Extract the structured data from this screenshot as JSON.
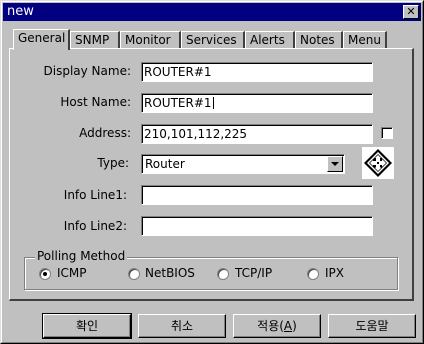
{
  "window": {
    "title": "new",
    "close_glyph": "✕"
  },
  "tabs": [
    {
      "label": "General",
      "active": true
    },
    {
      "label": "SNMP"
    },
    {
      "label": "Monitor"
    },
    {
      "label": "Services"
    },
    {
      "label": "Alerts"
    },
    {
      "label": "Notes"
    },
    {
      "label": "Menu"
    }
  ],
  "form": {
    "display_name_label": "Display Name:",
    "display_name_value": "ROUTER#1",
    "host_name_label": "Host Name:",
    "host_name_value": "ROUTER#1",
    "address_label": "Address:",
    "address_value": "210,101,112,225",
    "type_label": "Type:",
    "type_value": "Router",
    "info1_label": "Info Line1:",
    "info1_value": "",
    "info2_label": "Info Line2:",
    "info2_value": ""
  },
  "polling": {
    "title": "Polling Method",
    "options": [
      {
        "label": "ICMP",
        "checked": true
      },
      {
        "label": "NetBIOS",
        "checked": false
      },
      {
        "label": "TCP/IP",
        "checked": false
      },
      {
        "label": "IPX",
        "checked": false
      }
    ]
  },
  "buttons": {
    "ok": "확인",
    "cancel": "취소",
    "apply_prefix": "적용(",
    "apply_key": "A",
    "apply_suffix": ")",
    "help": "도움말"
  },
  "icons": {
    "type_icon": "router-icon",
    "close": "close-icon",
    "dropdown": "chevron-down-icon"
  },
  "colors": {
    "titlebar": "#000080",
    "face": "#c0c0c0"
  }
}
